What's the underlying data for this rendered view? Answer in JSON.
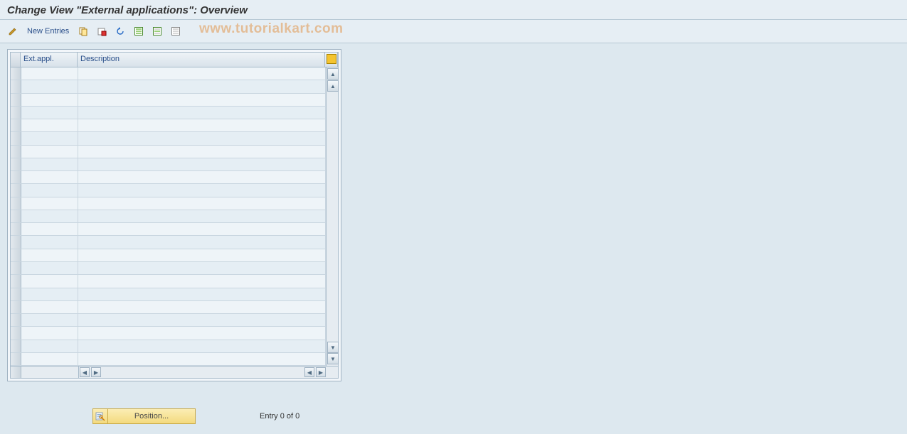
{
  "title": "Change View \"External applications\": Overview",
  "toolbar": {
    "new_entries_label": "New Entries"
  },
  "watermark": "www.tutorialkart.com",
  "table": {
    "columns": {
      "ext": "Ext.appl.",
      "desc": "Description"
    },
    "row_count": 23
  },
  "footer": {
    "position_label": "Position...",
    "entry_text": "Entry 0 of 0"
  }
}
